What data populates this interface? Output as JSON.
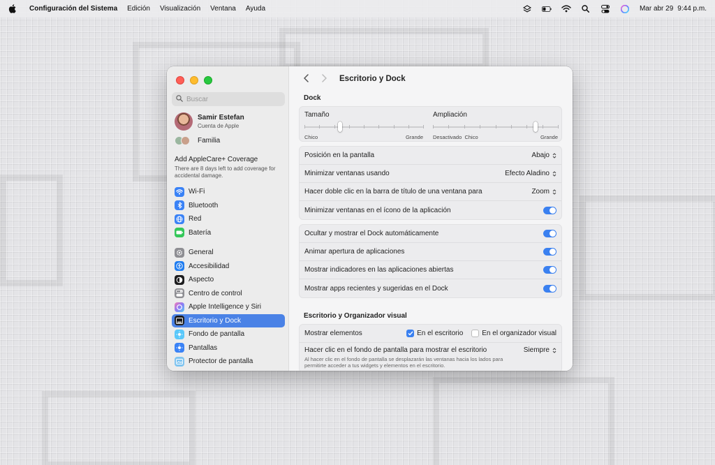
{
  "menubar": {
    "app_name": "Configuración del Sistema",
    "menus": [
      "Edición",
      "Visualización",
      "Ventana",
      "Ayuda"
    ],
    "date": "Mar abr 29",
    "time": "9:44 p.m."
  },
  "sidebar": {
    "search_placeholder": "Buscar",
    "account_name": "Samir Estefan",
    "account_sub": "Cuenta de Apple",
    "family_label": "Familia",
    "applecare_title": "Add AppleCare+ Coverage",
    "applecare_desc": "There are 8 days left to add coverage for accidental damage.",
    "group1": [
      {
        "label": "Wi-Fi",
        "icon": "wifi-icon",
        "color": "#3a82f6"
      },
      {
        "label": "Bluetooth",
        "icon": "bluetooth-icon",
        "color": "#3a82f6"
      },
      {
        "label": "Red",
        "icon": "globe-icon",
        "color": "#3a82f6"
      },
      {
        "label": "Batería",
        "icon": "battery-icon",
        "color": "#34c759"
      }
    ],
    "group2": [
      {
        "label": "General",
        "icon": "gear-icon",
        "color": "#8e8e93"
      },
      {
        "label": "Accesibilidad",
        "icon": "accessibility-icon",
        "color": "#1f7cf0"
      },
      {
        "label": "Aspecto",
        "icon": "appearance-icon",
        "color": "#1c1c1e"
      },
      {
        "label": "Centro de control",
        "icon": "control-center-icon",
        "color": "#8e8e93"
      },
      {
        "label": "Apple Intelligence y Siri",
        "icon": "siri-icon",
        "color": "#e36fb4"
      },
      {
        "label": "Escritorio y Dock",
        "icon": "dock-icon",
        "color": "#1c1c1e",
        "active": true
      },
      {
        "label": "Fondo de pantalla",
        "icon": "wallpaper-icon",
        "color": "#5ac8fa"
      },
      {
        "label": "Pantallas",
        "icon": "displays-icon",
        "color": "#3a82f6"
      },
      {
        "label": "Protector de pantalla",
        "icon": "screensaver-icon",
        "color": "#7fc4f0"
      }
    ]
  },
  "main": {
    "title": "Escritorio y Dock",
    "dock_section": "Dock",
    "size_label": "Tamaño",
    "size_min": "Chico",
    "size_max": "Grande",
    "size_value": 0.3,
    "magnify_label": "Ampliación",
    "magnify_min": "Desactivado",
    "magnify_mid": "Chico",
    "magnify_max": "Grande",
    "magnify_value": 0.82,
    "dock_rows": [
      {
        "label": "Posición en la pantalla",
        "value": "Abajo",
        "type": "select"
      },
      {
        "label": "Minimizar ventanas usando",
        "value": "Efecto Aladino",
        "type": "select"
      },
      {
        "label": "Hacer doble clic en la barra de título de una ventana para",
        "value": "Zoom",
        "type": "select"
      },
      {
        "label": "Minimizar ventanas en el ícono de la aplicación",
        "type": "toggle",
        "on": true
      }
    ],
    "dock_rows2": [
      {
        "label": "Ocultar y mostrar el Dock automáticamente",
        "on": true
      },
      {
        "label": "Animar apertura de aplicaciones",
        "on": true
      },
      {
        "label": "Mostrar indicadores en las aplicaciones abiertas",
        "on": true
      },
      {
        "label": "Mostrar apps recientes y sugeridas en el Dock",
        "on": true
      }
    ],
    "desktop_section": "Escritorio y Organizador visual",
    "show_items_label": "Mostrar elementos",
    "show_on_desktop": "En el escritorio",
    "show_on_desktop_checked": true,
    "show_in_stage": "En el organizador visual",
    "show_in_stage_checked": false,
    "click_wallpaper_label": "Hacer clic en el fondo de pantalla para mostrar el escritorio",
    "click_wallpaper_value": "Siempre",
    "click_wallpaper_desc": "Al hacer clic en el fondo de pantalla se desplazarán las ventanas hacia los lados para permitirte acceder a tus widgets y elementos en el escritorio."
  }
}
